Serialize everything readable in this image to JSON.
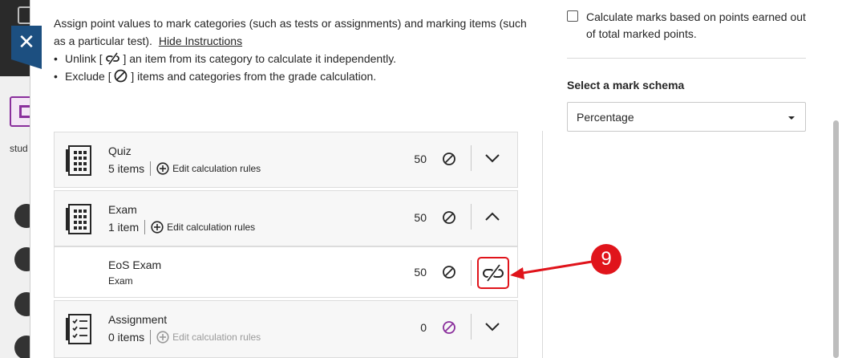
{
  "instructions": {
    "text": "Assign point values to mark categories (such as tests or assignments) and marking items (such as a particular test).",
    "hide_link": "Hide Instructions",
    "bullet_unlink_pre": "Unlink [",
    "bullet_unlink_post": "] an item from its category to calculate it independently.",
    "bullet_exclude_pre": "Exclude [",
    "bullet_exclude_post": "] items and categories from the grade calculation."
  },
  "right_panel": {
    "calc_checkbox_label": "Calculate marks based on points earned out of total marked points.",
    "schema_label": "Select a mark schema",
    "schema_value": "Percentage"
  },
  "background": {
    "student_text": "stud"
  },
  "close_label": "✕",
  "rows": [
    {
      "title": "Quiz",
      "count": "5 items",
      "rules": "Edit calculation rules",
      "points": "50",
      "icon": "quiz-calculator-icon",
      "toggle": "chevron-down-icon"
    },
    {
      "title": "Exam",
      "count": "1 item",
      "rules": "Edit calculation rules",
      "points": "50",
      "icon": "exam-calculator-icon",
      "toggle": "chevron-up-icon"
    },
    {
      "title": "EoS Exam",
      "subtitle": "Exam",
      "points": "50",
      "toggle": "unlink-icon"
    },
    {
      "title": "Assignment",
      "count": "0 items",
      "rules": "Edit calculation rules",
      "points": "0",
      "icon": "checklist-icon",
      "toggle": "chevron-down-icon"
    }
  ],
  "annotation": {
    "number": "9"
  },
  "colors": {
    "accent_red": "#e0141b",
    "close_tab": "#1c4f80",
    "purple": "#8a2f9c"
  }
}
